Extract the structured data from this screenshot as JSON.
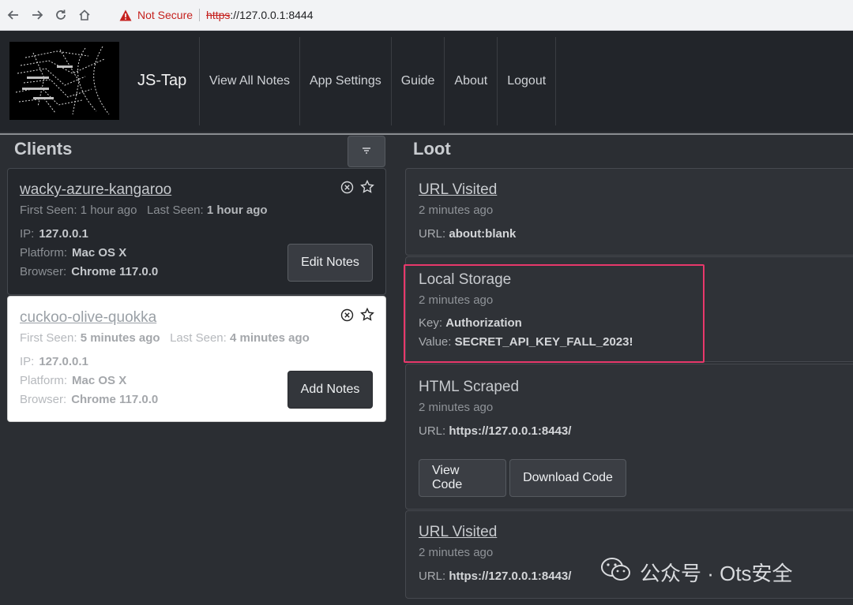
{
  "browser": {
    "not_secure": "Not Secure",
    "url_scheme": "https",
    "url_rest": "://127.0.0.1:8444"
  },
  "nav": {
    "brand": "JS-Tap",
    "items": [
      "View All Notes",
      "App Settings",
      "Guide",
      "About",
      "Logout"
    ]
  },
  "clients": {
    "title": "Clients",
    "cards": [
      {
        "name": "wacky-azure-kangaroo",
        "first_seen_label": "First Seen:",
        "first_seen": "1 hour ago",
        "last_seen_label": "Last Seen:",
        "last_seen": "1 hour ago",
        "ip_label": "IP:",
        "ip": "127.0.0.1",
        "platform_label": "Platform:",
        "platform": "Mac OS X",
        "browser_label": "Browser:",
        "browser": "Chrome 117.0.0",
        "button": "Edit Notes"
      },
      {
        "name": "cuckoo-olive-quokka",
        "first_seen_label": "First Seen:",
        "first_seen": "5 minutes ago",
        "last_seen_label": "Last Seen:",
        "last_seen": "4 minutes ago",
        "ip_label": "IP:",
        "ip": "127.0.0.1",
        "platform_label": "Platform:",
        "platform": "Mac OS X",
        "browser_label": "Browser:",
        "browser": "Chrome 117.0.0",
        "button": "Add Notes"
      }
    ]
  },
  "loot": {
    "title": "Loot",
    "items": [
      {
        "title": "URL Visited",
        "time": "2 minutes ago",
        "k1": "URL:",
        "v1": "about:blank"
      },
      {
        "title": "Local Storage",
        "time": "2 minutes ago",
        "k1": "Key:",
        "v1": "Authorization",
        "k2": "Value:",
        "v2": "SECRET_API_KEY_FALL_2023!"
      },
      {
        "title": "HTML Scraped",
        "time": "2 minutes ago",
        "k1": "URL:",
        "v1": "https://127.0.0.1:8443/",
        "btn1": "View Code",
        "btn2": "Download Code"
      },
      {
        "title": "URL Visited",
        "time": "2 minutes ago",
        "k1": "URL:",
        "v1": "https://127.0.0.1:8443/"
      }
    ]
  },
  "watermark": "公众号 · Ots安全",
  "colors": {
    "highlight": "#e8386b",
    "not_secure": "#c5221f"
  }
}
